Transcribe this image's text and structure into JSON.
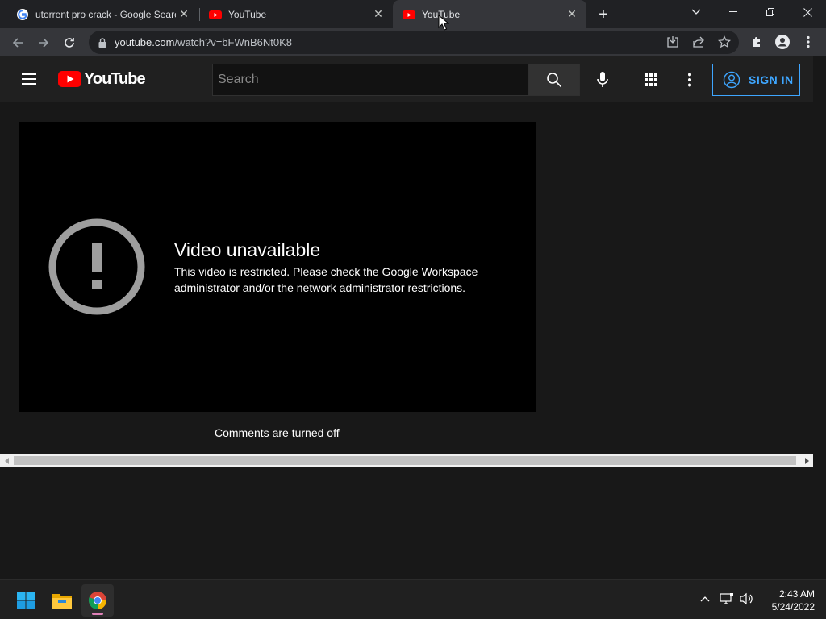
{
  "browser": {
    "tabs": [
      {
        "title": "utorrent pro crack - Google Search",
        "favicon": "google-icon",
        "active": false
      },
      {
        "title": "YouTube",
        "favicon": "youtube-icon",
        "active": false
      },
      {
        "title": "YouTube",
        "favicon": "youtube-icon",
        "active": true
      }
    ],
    "url_host": "youtube.com",
    "url_path": "/watch?v=bFWnB6Nt0K8"
  },
  "youtube": {
    "logo_text": "YouTube",
    "search_placeholder": "Search",
    "sign_in_label": "SIGN IN",
    "error_title": "Video unavailable",
    "error_message": "This video is restricted. Please check the Google Workspace administrator and/or the network administrator restrictions.",
    "comments_status": "Comments are turned off",
    "accent_color": "#3ea6ff",
    "brand_red": "#ff0000"
  },
  "taskbar": {
    "apps": [
      "start-icon",
      "file-explorer-icon",
      "chrome-icon"
    ],
    "time": "2:43 AM",
    "date": "5/24/2022"
  }
}
